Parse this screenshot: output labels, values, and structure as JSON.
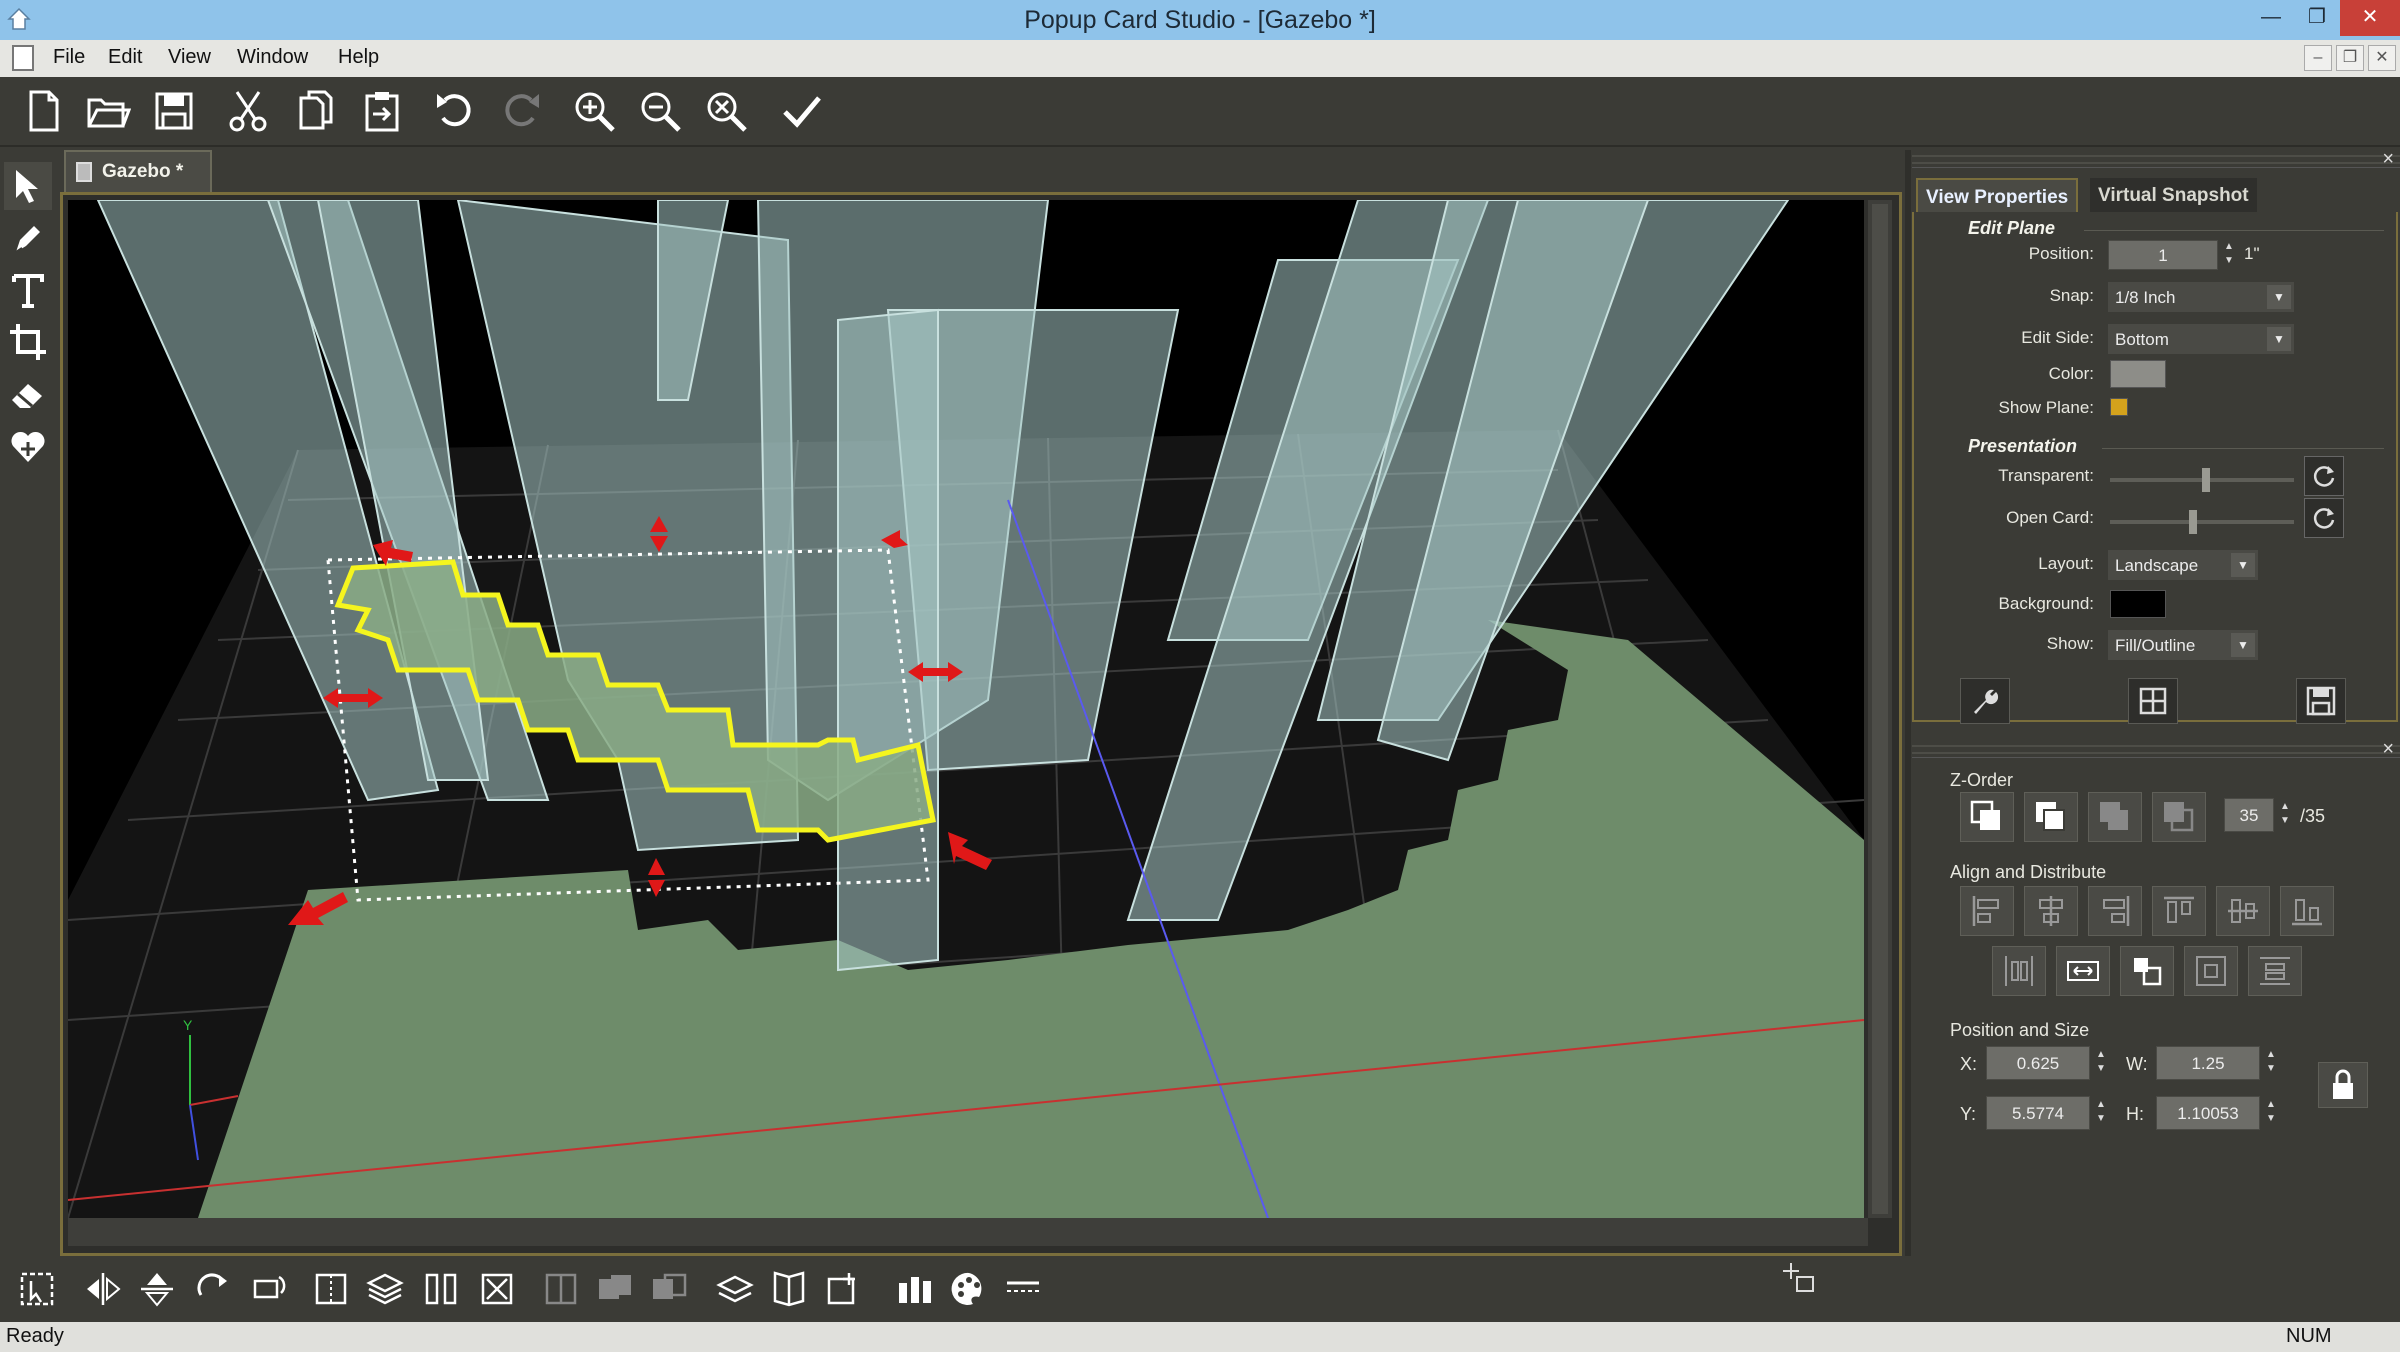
{
  "window": {
    "title": "Popup Card Studio - [Gazebo *]"
  },
  "menu": {
    "items": [
      "File",
      "Edit",
      "View",
      "Window",
      "Help"
    ]
  },
  "document": {
    "tab_label": "Gazebo *"
  },
  "view_properties": {
    "tabs": [
      "View Properties",
      "Virtual Snapshot"
    ],
    "edit_plane": {
      "title": "Edit Plane",
      "position_label": "Position:",
      "position_value": "1",
      "position_unit": "1\"",
      "snap_label": "Snap:",
      "snap_value": "1/8 Inch",
      "edit_side_label": "Edit Side:",
      "edit_side_value": "Bottom",
      "color_label": "Color:",
      "color_value": "#8d8d88",
      "show_plane_label": "Show Plane:",
      "show_plane_color": "#d4a21c"
    },
    "presentation": {
      "title": "Presentation",
      "transparent_label": "Transparent:",
      "transparent_level": 0.52,
      "open_card_label": "Open Card:",
      "open_card_level": 0.45,
      "layout_label": "Layout:",
      "layout_value": "Landscape",
      "background_label": "Background:",
      "background_color": "#000000",
      "show_label": "Show:",
      "show_value": "Fill/Outline"
    }
  },
  "arrange": {
    "zorder_title": "Z-Order",
    "zorder_value": "35",
    "zorder_total": "/35",
    "align_title": "Align and Distribute",
    "possize_title": "Position and Size",
    "x_label": "X:",
    "x_value": "0.625",
    "y_label": "Y:",
    "y_value": "5.5774",
    "w_label": "W:",
    "w_value": "1.25",
    "h_label": "H:",
    "h_value": "1.10053"
  },
  "status": {
    "left": "Ready",
    "num": "NUM"
  },
  "colors": {
    "selection": "#f5f51e",
    "handle": "#e01818",
    "accent_border": "#7a6e3c",
    "plane": "#6e8c6a"
  }
}
